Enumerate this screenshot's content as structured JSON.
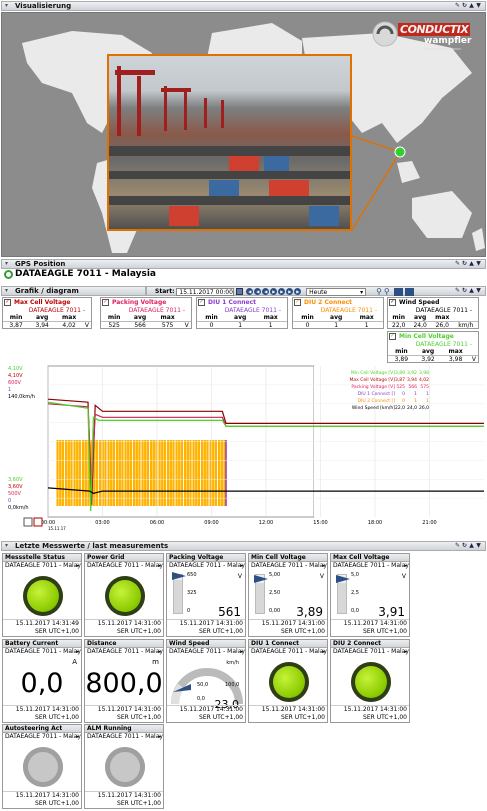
{
  "visualisierung": {
    "title": "Visualisierung",
    "logo_main": "CONDUCTIX",
    "logo_sub": "wampfler",
    "logo_tag": "A DELACHAUX COMPANY"
  },
  "gps": {
    "title": "GPS Position",
    "device": "DATAEAGLE 7011 - Malaysia"
  },
  "grafik": {
    "title": "Grafik / diagram",
    "start_label": "Start:",
    "start_value": "15.11.2017 00:00",
    "range_value": "Heute"
  },
  "series_boxes": [
    {
      "title": "Max Cell Voltage",
      "source": "DATAEAGLE 7011 -",
      "min": "3,87",
      "avg": "3,94",
      "max": "4,02",
      "unit": "V",
      "color": "#c00000"
    },
    {
      "title": "Packing Voltage",
      "source": "DATAEAGLE 7011 -",
      "min": "525",
      "avg": "566",
      "max": "575",
      "unit": "V",
      "color": "#e0205c"
    },
    {
      "title": "DIU 1 Connect",
      "source": "DATAEAGLE 7011 -",
      "min": "0",
      "avg": "1",
      "max": "1",
      "unit": "",
      "color": "#8a3ad0"
    },
    {
      "title": "DIU 2 Connect",
      "source": "DATAEAGLE 7011 -",
      "min": "0",
      "avg": "1",
      "max": "1",
      "unit": "",
      "color": "#ff8c00"
    },
    {
      "title": "Wind Speed",
      "source": "DATAEAGLE 7011 -",
      "min": "22,0",
      "avg": "24,0",
      "max": "26,0",
      "unit": "km/h",
      "color": "#000000"
    },
    {
      "title": "Min Cell Voltage",
      "source": "DATAEAGLE 7011 -",
      "min": "3,89",
      "avg": "3,92",
      "max": "3,98",
      "unit": "V",
      "color": "#4cd12a"
    }
  ],
  "stat_headers": {
    "min": "min",
    "avg": "avg",
    "max": "max"
  },
  "chart_data": {
    "type": "line",
    "x_ticks": [
      "00:00",
      "03:00",
      "06:00",
      "09:00",
      "12:00",
      "15:00",
      "18:00",
      "21:00"
    ],
    "date_label": "15.11.17",
    "tz_label": "Server Zeit UTC+1:00",
    "y_left_top": [
      "4,10V",
      "4,10V",
      "600V",
      "1",
      "140,0km/h"
    ],
    "y_left_bottom": [
      "3,60V",
      "3,60V",
      "500V",
      "0",
      "0,0km/h"
    ],
    "legend": [
      {
        "name": "Min Cell Voltage [V]",
        "min": "3,89",
        "avg": "3,92",
        "max": "3,98",
        "color": "#4cd12a"
      },
      {
        "name": "Max Cell Voltage [V]",
        "min": "3,87",
        "avg": "3,94",
        "max": "4,02",
        "color": "#c00000"
      },
      {
        "name": "Packing Voltage [V]",
        "min": "525",
        "avg": "566",
        "max": "575",
        "color": "#e0205c"
      },
      {
        "name": "DIU 1 Connect []",
        "min": "0",
        "avg": "1",
        "max": "1",
        "color": "#8a3ad0"
      },
      {
        "name": "DIU 2 Connect []",
        "min": "0",
        "avg": "1",
        "max": "1",
        "color": "#ff8c00"
      },
      {
        "name": "Wind Speed [km/h]",
        "min": "22,0",
        "avg": "24,0",
        "max": "26,0",
        "color": "#000000"
      }
    ],
    "series": [
      {
        "name": "Max Cell Voltage",
        "color": "#8b0000",
        "x": [
          0,
          2.2,
          2.4,
          2.6,
          3.0,
          9.6,
          9.8,
          24
        ],
        "y": [
          3.99,
          3.98,
          3.64,
          3.97,
          3.95,
          3.95,
          3.91,
          3.91
        ]
      },
      {
        "name": "Packing Voltage",
        "color": "#d02050",
        "x": [
          0,
          2.2,
          2.4,
          2.6,
          3.0,
          9.6,
          9.8,
          24
        ],
        "y": [
          575,
          573,
          520,
          568,
          566,
          566,
          560,
          560
        ]
      },
      {
        "name": "Min Cell Voltage",
        "color": "#4cd12a",
        "x": [
          0,
          2.2,
          2.35,
          2.5,
          2.8,
          9.6,
          9.8,
          24
        ],
        "y": [
          3.98,
          3.96,
          3.62,
          3.93,
          3.92,
          3.92,
          3.9,
          3.9
        ]
      },
      {
        "name": "Wind Speed",
        "color": "#000000",
        "x": [
          0,
          2.3,
          2.5,
          3.0,
          24
        ],
        "y": [
          27,
          24,
          22,
          24,
          24
        ]
      }
    ],
    "diu2_window": [
      0,
      9.8
    ],
    "diu1_window": [
      0,
      9.8
    ]
  },
  "measurements": {
    "title": "Letzte Messwerte / last measurements",
    "tiles": [
      {
        "title": "Messstelle Status",
        "source": "DATAEAGLE 7011 - Malay",
        "kind": "lamp-on",
        "ts": "15.11.2017 14:31:49",
        "tz": "SER UTC+1,00"
      },
      {
        "title": "Power Grid",
        "source": "DATAEAGLE 7011 - Malay",
        "kind": "lamp-on",
        "ts": "15.11.2017 14:31:00",
        "tz": "SER UTC+1,00"
      },
      {
        "title": "Packing Voltage",
        "source": "DATAEAGLE 7011 - Malay",
        "kind": "bar",
        "unit": "V",
        "ticks": [
          "650",
          "325",
          "0"
        ],
        "value": "561",
        "fill": 0.86,
        "ts": "15.11.2017 14:31:00",
        "tz": "SER UTC+1,00"
      },
      {
        "title": "Min Cell Voltage",
        "source": "DATAEAGLE 7011 - Malay",
        "kind": "bar",
        "unit": "V",
        "ticks": [
          "5,00",
          "2,50",
          "0,00"
        ],
        "value": "3,89",
        "fill": 0.78,
        "ts": "15.11.2017 14:31:00",
        "tz": "SER UTC+1,00"
      },
      {
        "title": "Max Cell Voltage",
        "source": "DATAEAGLE 7011 - Malay",
        "kind": "bar",
        "unit": "V",
        "ticks": [
          "5,0",
          "2,5",
          "0,0"
        ],
        "value": "3,91",
        "fill": 0.78,
        "ts": "15.11.2017 14:31:00",
        "tz": "SER UTC+1,00"
      },
      {
        "title": "Battery Current",
        "source": "DATAEAGLE 7011 - Malay",
        "kind": "number",
        "unit": "A",
        "value": "0,0",
        "ts": "15.11.2017 14:31:00",
        "tz": "SER UTC+1,00"
      },
      {
        "title": "Distance",
        "source": "DATAEAGLE 7011 - Malay",
        "kind": "number",
        "unit": "m",
        "value": "800,0",
        "ts": "15.11.2017 14:31:00",
        "tz": "SER UTC+1,00"
      },
      {
        "title": "Wind Speed",
        "source": "DATAEAGLE 7011 - Malay",
        "kind": "gauge",
        "unit": "km/h",
        "ticks": [
          "0,0",
          "50,0",
          "100,0"
        ],
        "value": "23,0",
        "fill": 0.23,
        "ts": "15.11.2017 14:31:00",
        "tz": "SER UTC+1,00"
      },
      {
        "title": "DIU 1 Connect",
        "source": "DATAEAGLE 7011 - Malay",
        "kind": "lamp-on",
        "ts": "15.11.2017 14:31:00",
        "tz": "SER UTC+1,00"
      },
      {
        "title": "DIU 2 Connect",
        "source": "DATAEAGLE 7011 - Malay",
        "kind": "lamp-on",
        "ts": "15.11.2017 14:31:00",
        "tz": "SER UTC+1,00"
      },
      {
        "title": "Autosteering Act",
        "source": "DATAEAGLE 7011 - Malay",
        "kind": "lamp-off",
        "ts": "15.11.2017 14:31:00",
        "tz": "SER UTC+1,00"
      },
      {
        "title": "ALM Running",
        "source": "DATAEAGLE 7011 - Malay",
        "kind": "lamp-off",
        "ts": "15.11.2017 14:31:00",
        "tz": "SER UTC+1,00"
      }
    ]
  }
}
